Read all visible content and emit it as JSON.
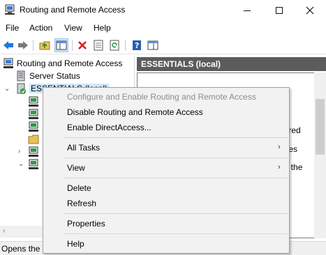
{
  "window": {
    "title": "Routing and Remote Access"
  },
  "menubar": [
    "File",
    "Action",
    "View",
    "Help"
  ],
  "toolbar": {
    "icons": [
      "back-icon",
      "forward-icon",
      "up-folder-icon",
      "show-hide-tree-icon",
      "delete-icon",
      "properties-icon",
      "refresh-icon",
      "help-icon",
      "console-icon"
    ]
  },
  "tree": {
    "root": "Routing and Remote Access",
    "server_status": "Server Status",
    "server": "ESSENTIALS (local)"
  },
  "right_pane": {
    "header": "ESSENTIALS (local)",
    "fragments": [
      "gured",
      "ss",
      "nges",
      "an",
      "on the"
    ]
  },
  "context_menu": {
    "items": [
      {
        "label": "Configure and Enable Routing and Remote Access",
        "enabled": false
      },
      {
        "label": "Disable Routing and Remote Access",
        "enabled": true
      },
      {
        "label": "Enable DirectAccess...",
        "enabled": true
      },
      {
        "label": "All Tasks",
        "enabled": true,
        "submenu": true
      },
      {
        "label": "View",
        "enabled": true,
        "submenu": true
      },
      {
        "label": "Delete",
        "enabled": true
      },
      {
        "label": "Refresh",
        "enabled": true
      },
      {
        "label": "Properties",
        "enabled": true
      },
      {
        "label": "Help",
        "enabled": true
      }
    ]
  },
  "status_bar": {
    "text": "Opens the p"
  },
  "colors": {
    "header_bg": "#5c5c5c",
    "selection": "#cce8ff",
    "menu_bg": "#f2f2f2"
  }
}
